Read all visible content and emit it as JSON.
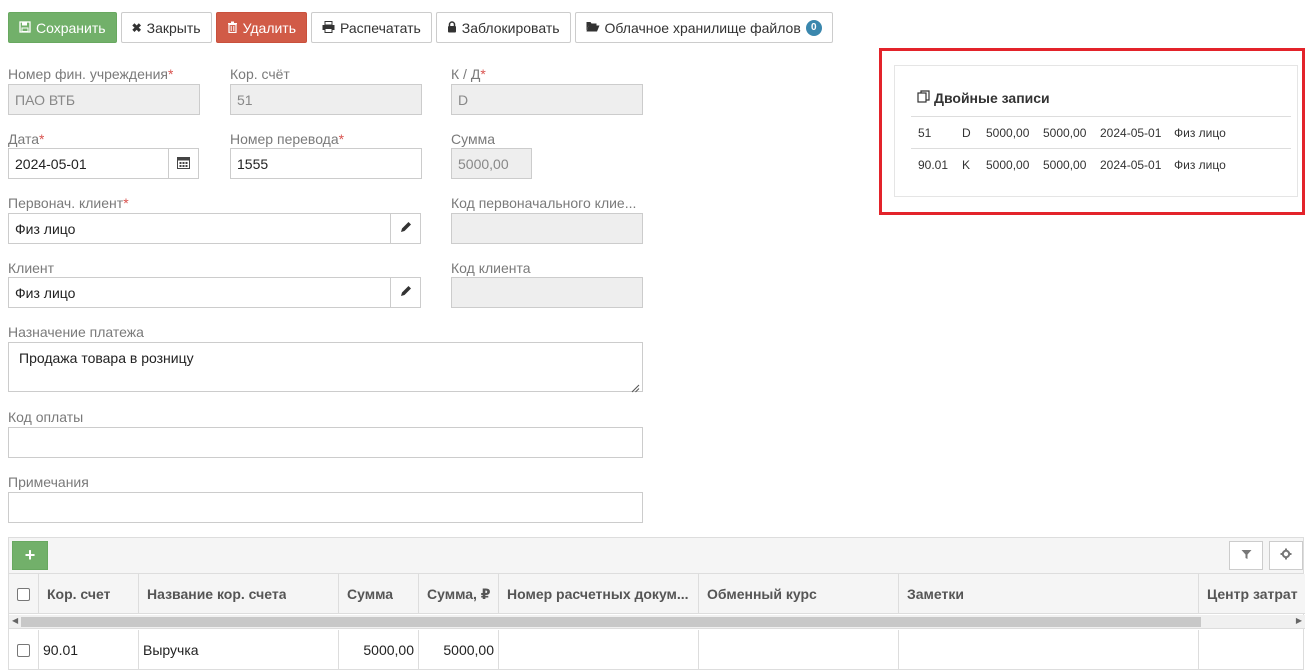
{
  "toolbar": {
    "save": "Сохранить",
    "close": "Закрыть",
    "delete": "Удалить",
    "print": "Распечатать",
    "lock": "Заблокировать",
    "cloud": "Облачное хранилище файлов",
    "cloud_count": "0"
  },
  "form": {
    "fin_inst_label": "Номер фин. учреждения",
    "fin_inst_value": "ПАО ВТБ",
    "corr_account_label": "Кор. счёт",
    "corr_account_value": "51",
    "kd_label": "К / Д",
    "kd_value": "D",
    "date_label": "Дата",
    "date_value": "2024-05-01",
    "transfer_label": "Номер перевода",
    "transfer_value": "1555",
    "amount_label": "Сумма",
    "amount_value": "5000,00",
    "orig_client_label": "Первонач. клиент",
    "orig_client_value": "Физ лицо",
    "orig_client_code_label": "Код первоначального клие...",
    "client_label": "Клиент",
    "client_value": "Физ лицо",
    "client_code_label": "Код клиента",
    "purpose_label": "Назначение платежа",
    "purpose_value": "Продажа товара в розницу",
    "payment_code_label": "Код оплаты",
    "notes_label": "Примечания",
    "required_mark": "*"
  },
  "double_entries": {
    "title": "Двойные записи",
    "rows": [
      [
        "51",
        "D",
        "5000,00",
        "5000,00",
        "2024-05-01",
        "Физ лицо"
      ],
      [
        "90.01",
        "K",
        "5000,00",
        "5000,00",
        "2024-05-01",
        "Физ лицо"
      ]
    ]
  },
  "grid": {
    "add": "+",
    "columns": [
      "Кор. счет",
      "Название кор. счета",
      "Сумма",
      "Сумма, ₽",
      "Номер расчетных докум...",
      "Обменный курс",
      "Заметки",
      "Центр затрат"
    ],
    "rows": [
      [
        "90.01",
        "Выручка",
        "5000,00",
        "5000,00",
        "",
        "",
        "",
        ""
      ]
    ]
  },
  "colors": {
    "success": "#72b06a",
    "danger": "#d15b47",
    "highlight_frame": "#e3232a",
    "required": "#d9534f"
  }
}
